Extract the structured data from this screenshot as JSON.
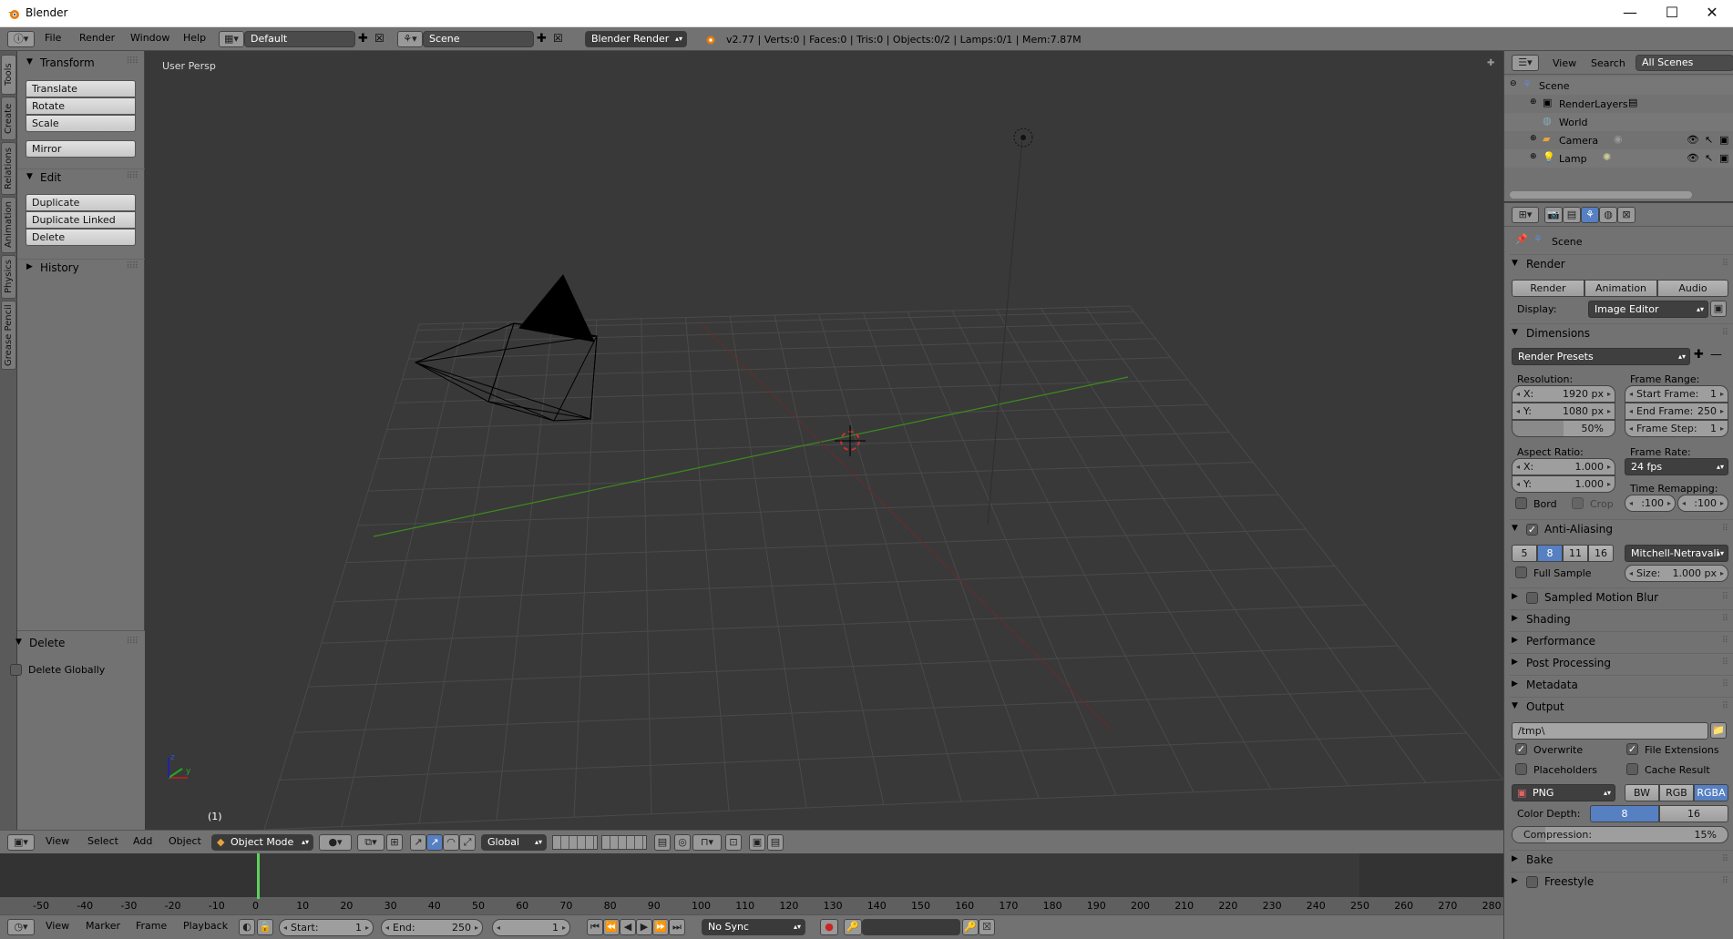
{
  "window": {
    "title": "Blender"
  },
  "info_header": {
    "menus": [
      "File",
      "Render",
      "Window",
      "Help"
    ],
    "screen_layout": "Default",
    "scene": "Scene",
    "engine": "Blender Render",
    "stats": "v2.77 | Verts:0 | Faces:0 | Tris:0 | Objects:0/2 | Lamps:0/1 | Mem:7.87M"
  },
  "tool_tabs": [
    "Tools",
    "Create",
    "Relations",
    "Animation",
    "Physics",
    "Grease Pencil"
  ],
  "tool_shelf": {
    "transform": {
      "title": "Transform",
      "buttons": [
        "Translate",
        "Rotate",
        "Scale",
        "Mirror"
      ]
    },
    "edit": {
      "title": "Edit",
      "buttons": [
        "Duplicate",
        "Duplicate Linked",
        "Delete"
      ]
    },
    "history": {
      "title": "History"
    },
    "operator": {
      "title": "Delete",
      "option": "Delete Globally"
    }
  },
  "viewport": {
    "label": "User Persp",
    "frame_indicator": "(1)"
  },
  "view3d_header": {
    "menus": [
      "View",
      "Select",
      "Add",
      "Object"
    ],
    "mode": "Object Mode",
    "orientation": "Global"
  },
  "timeline": {
    "ticks": [
      "-50",
      "-40",
      "-30",
      "-20",
      "-10",
      "0",
      "10",
      "20",
      "30",
      "40",
      "50",
      "60",
      "70",
      "80",
      "90",
      "100",
      "110",
      "120",
      "130",
      "140",
      "150",
      "160",
      "170",
      "180",
      "190",
      "200",
      "210",
      "220",
      "230",
      "240",
      "250",
      "260",
      "270",
      "280"
    ],
    "current_frame": 1,
    "menus": [
      "View",
      "Marker",
      "Frame",
      "Playback"
    ],
    "start_label": "Start:",
    "start": "1",
    "end_label": "End:",
    "end": "250",
    "frame": "1",
    "sync": "No Sync"
  },
  "outliner": {
    "menus": [
      "View",
      "Search"
    ],
    "filter": "All Scenes",
    "items": [
      "Scene",
      "RenderLayers",
      "World",
      "Camera",
      "Lamp"
    ]
  },
  "properties": {
    "context": "Scene",
    "render": {
      "title": "Render",
      "buttons": [
        "Render",
        "Animation",
        "Audio"
      ],
      "display_label": "Display:",
      "display": "Image Editor"
    },
    "dimensions": {
      "title": "Dimensions",
      "presets": "Render Presets",
      "resolution_label": "Resolution:",
      "res_x": "1920 px",
      "res_y": "1080 px",
      "res_pct": "50%",
      "frame_range_label": "Frame Range:",
      "start_frame_label": "Start Frame:",
      "start_frame": "1",
      "end_frame_label": "End Frame:",
      "end_frame": "250",
      "frame_step_label": "Frame Step:",
      "frame_step": "1",
      "aspect_label": "Aspect Ratio:",
      "aspect_x": "1.000",
      "aspect_y": "1.000",
      "frame_rate_label": "Frame Rate:",
      "frame_rate": "24 fps",
      "time_remap_label": "Time Remapping:",
      "remap_old": ":100",
      "remap_new": ":100",
      "bord": "Bord",
      "crop": "Crop"
    },
    "anti_aliasing": {
      "title": "Anti-Aliasing",
      "samples": [
        "5",
        "8",
        "11",
        "16"
      ],
      "selected_sample": "8",
      "filter": "Mitchell-Netravali",
      "full_sample": "Full Sample",
      "size_label": "Size:",
      "size": "1.000 px"
    },
    "collapsed_panels": [
      "Sampled Motion Blur",
      "Shading",
      "Performance",
      "Post Processing",
      "Metadata"
    ],
    "output": {
      "title": "Output",
      "path": "/tmp\\",
      "overwrite": "Overwrite",
      "file_extensions": "File Extensions",
      "placeholders": "Placeholders",
      "cache_result": "Cache Result",
      "format": "PNG",
      "color_modes": [
        "BW",
        "RGB",
        "RGBA"
      ],
      "color_mode_selected": "RGBA",
      "color_depth_label": "Color Depth:",
      "depths": [
        "8",
        "16"
      ],
      "compression_label": "Compression:",
      "compression": "15%",
      "compression_value": 0.15
    },
    "bottom_panels": [
      "Bake",
      "Freestyle"
    ]
  },
  "colors": {
    "accent": "#5680c2",
    "panel": "#727272",
    "viewport": "#393939",
    "x_axis": "#8b2a2a",
    "y_axis": "#3d8b1f"
  }
}
